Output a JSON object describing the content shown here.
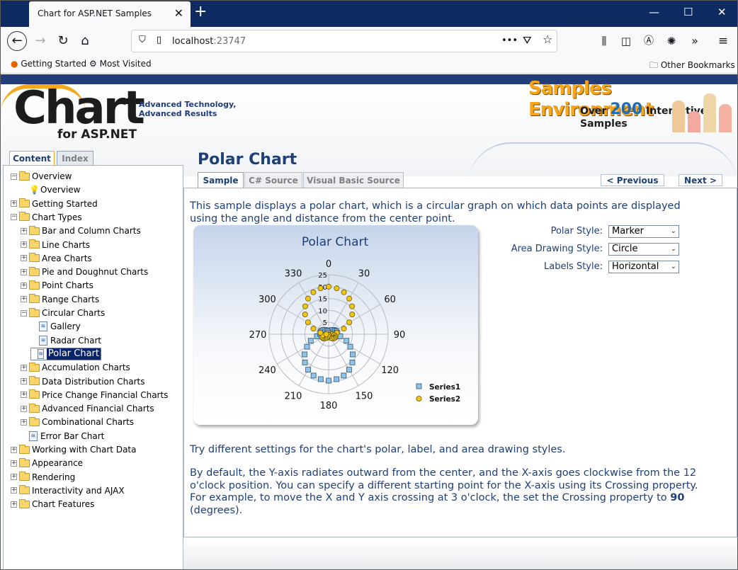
{
  "browser": {
    "tab_title": "Chart for ASP.NET Samples",
    "url_host": "localhost",
    "url_port": ":23747",
    "bookmarks": [
      "Getting Started",
      "Most Visited"
    ],
    "other_bookmarks": "Other Bookmarks",
    "menu_dots": "•••"
  },
  "banner": {
    "logo_word": "Chart",
    "logo_sub": "for ASP.NET",
    "tagline_line1": "Advanced Technology,",
    "tagline_line2": "Advanced Results",
    "samples_title": "Samples Environment",
    "samples_over": "Over",
    "samples_count": "200",
    "samples_rest": "Interactive Samples"
  },
  "sidebar": {
    "tabs": [
      "Content",
      "Index"
    ],
    "tree": [
      {
        "label": "Overview",
        "type": "folder",
        "exp": "−",
        "level": 0
      },
      {
        "label": "Overview",
        "type": "bulb",
        "level": 1
      },
      {
        "label": "Getting Started",
        "type": "folder",
        "exp": "+",
        "level": 0
      },
      {
        "label": "Chart Types",
        "type": "folder",
        "exp": "−",
        "level": 0
      },
      {
        "label": "Bar and Column Charts",
        "type": "folder",
        "exp": "+",
        "level": 1
      },
      {
        "label": "Line Charts",
        "type": "folder",
        "exp": "+",
        "level": 1
      },
      {
        "label": "Area Charts",
        "type": "folder",
        "exp": "+",
        "level": 1
      },
      {
        "label": "Pie and Doughnut Charts",
        "type": "folder",
        "exp": "+",
        "level": 1
      },
      {
        "label": "Point Charts",
        "type": "folder",
        "exp": "+",
        "level": 1
      },
      {
        "label": "Range Charts",
        "type": "folder",
        "exp": "+",
        "level": 1
      },
      {
        "label": "Circular Charts",
        "type": "folder",
        "exp": "−",
        "level": 1
      },
      {
        "label": "Gallery",
        "type": "doc",
        "level": 2
      },
      {
        "label": "Radar Chart",
        "type": "doc",
        "level": 2
      },
      {
        "label": "Polar Chart",
        "type": "doc",
        "level": 2,
        "selected": true
      },
      {
        "label": "Accumulation Charts",
        "type": "folder",
        "exp": "+",
        "level": 1
      },
      {
        "label": "Data Distribution Charts",
        "type": "folder",
        "exp": "+",
        "level": 1
      },
      {
        "label": "Price Change Financial Charts",
        "type": "folder",
        "exp": "+",
        "level": 1
      },
      {
        "label": "Advanced Financial Charts",
        "type": "folder",
        "exp": "+",
        "level": 1
      },
      {
        "label": "Combinational Charts",
        "type": "folder",
        "exp": "+",
        "level": 1
      },
      {
        "label": "Error Bar Chart",
        "type": "doc",
        "level": 1
      },
      {
        "label": "Working with Chart Data",
        "type": "folder",
        "exp": "+",
        "level": 0
      },
      {
        "label": "Appearance",
        "type": "folder",
        "exp": "+",
        "level": 0
      },
      {
        "label": "Rendering",
        "type": "folder",
        "exp": "+",
        "level": 0
      },
      {
        "label": "Interactivity and AJAX",
        "type": "folder",
        "exp": "+",
        "level": 0
      },
      {
        "label": "Chart Features",
        "type": "folder",
        "exp": "+",
        "level": 0
      }
    ]
  },
  "main": {
    "title": "Polar Chart",
    "tabs": [
      "Sample",
      "C# Source",
      "Visual Basic Source"
    ],
    "prev": "< Previous",
    "next": "Next >",
    "intro": "This sample displays a polar chart, which is a circular graph on which data points are displayed using the angle and distance from the center point.",
    "controls": [
      {
        "label": "Polar Style:",
        "value": "Marker"
      },
      {
        "label": "Area Drawing Style:",
        "value": "Circle"
      },
      {
        "label": "Labels Style:",
        "value": "Horizontal"
      }
    ],
    "para2": "Try different settings for the chart's polar, label, and area drawing styles.",
    "para3_a": "By default, the Y-axis radiates outward from the center, and the X-axis goes clockwise from the 12 o'clock position. You can specify a different starting point for the X-axis using its Crossing property. For example, to move the X and Y axis crossing at 3 o'clock, the set the Crossing property to ",
    "para3_b": "90",
    "para3_c": " (degrees)."
  },
  "chart_data": {
    "type": "scatter",
    "title": "Polar Chart",
    "angle_labels": [
      "0",
      "30",
      "60",
      "90",
      "120",
      "150",
      "180",
      "210",
      "240",
      "270",
      "300",
      "330"
    ],
    "radial_labels": [
      "0",
      "5",
      "10",
      "15",
      "20",
      "25"
    ],
    "rmax": 25,
    "legend_position": "right",
    "series": [
      {
        "name": "Series1",
        "marker": "square",
        "color": "#8fc3ea",
        "angles": [
          0,
          10,
          20,
          30,
          40,
          50,
          60,
          70,
          80,
          90,
          100,
          110,
          120,
          130,
          140,
          150,
          160,
          170,
          180,
          190,
          200,
          210,
          220,
          230,
          240,
          250,
          260,
          270,
          280,
          290,
          300,
          310,
          320,
          330,
          340,
          350
        ],
        "values": [
          0,
          0.6,
          1.2,
          1.8,
          2.3,
          2.8,
          3.1,
          3.4,
          3.5,
          3.5,
          5,
          8,
          10.5,
          13.2,
          15.5,
          17.2,
          18.5,
          19.2,
          19.5,
          19.2,
          18.5,
          17.2,
          15.5,
          13.2,
          10.5,
          8,
          5,
          3.5,
          3.5,
          3.4,
          3.1,
          2.8,
          2.3,
          1.8,
          1.2,
          0.6
        ]
      },
      {
        "name": "Series2",
        "marker": "circle",
        "color": "#f2c418",
        "angles": [
          0,
          10,
          20,
          30,
          40,
          50,
          60,
          70,
          80,
          90,
          100,
          110,
          120,
          130,
          140,
          150,
          160,
          170,
          180,
          190,
          200,
          210,
          220,
          230,
          240,
          250,
          260,
          270,
          280,
          290,
          300,
          310,
          320,
          330,
          340,
          350
        ],
        "values": [
          20,
          19.6,
          18.8,
          17.3,
          15.3,
          12.9,
          10,
          6.8,
          3.5,
          1,
          2.5,
          3,
          3,
          2.8,
          2.3,
          1.8,
          1,
          0.3,
          0,
          0.3,
          1,
          1.8,
          2.3,
          2.8,
          3,
          3,
          2.5,
          1,
          3.5,
          6.8,
          10,
          12.9,
          15.3,
          17.3,
          18.8,
          19.6
        ]
      }
    ]
  }
}
